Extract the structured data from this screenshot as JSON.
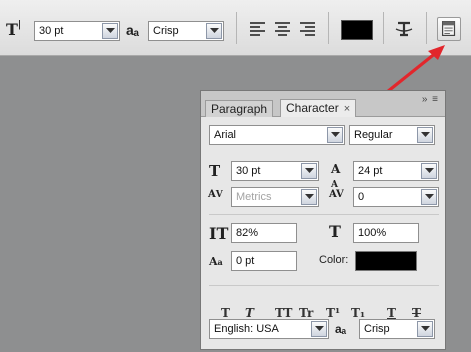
{
  "options_bar": {
    "font_size": "30 pt",
    "antialias_icon_text": "aₐ",
    "antialias": "Crisp",
    "text_color": "#000000",
    "icons": [
      "text-orientation-icon",
      "font-size-icon",
      "antialias-icon",
      "align-left-icon",
      "align-center-icon",
      "align-right-icon",
      "warp-text-icon",
      "toggle-panels-icon"
    ]
  },
  "panel": {
    "tabs": [
      {
        "label": "Paragraph"
      },
      {
        "label": "Character",
        "close": "×"
      }
    ],
    "menu_icon": "≡",
    "collapse_icon": "»",
    "font_family": "Arial",
    "font_style": "Regular",
    "font_size": "30 pt",
    "leading": "24 pt",
    "kerning": "Metrics",
    "tracking": "0",
    "vertical_scale": "82%",
    "horizontal_scale": "100%",
    "baseline_shift": "0 pt",
    "color_label": "Color:",
    "color": "#000000",
    "style_buttons": [
      "T",
      "T",
      "TT",
      "Tr",
      "T¹",
      "T₁",
      "T",
      "T"
    ],
    "language": "English: USA",
    "antialias_icon_text": "aₐ",
    "antialias": "Crisp"
  }
}
